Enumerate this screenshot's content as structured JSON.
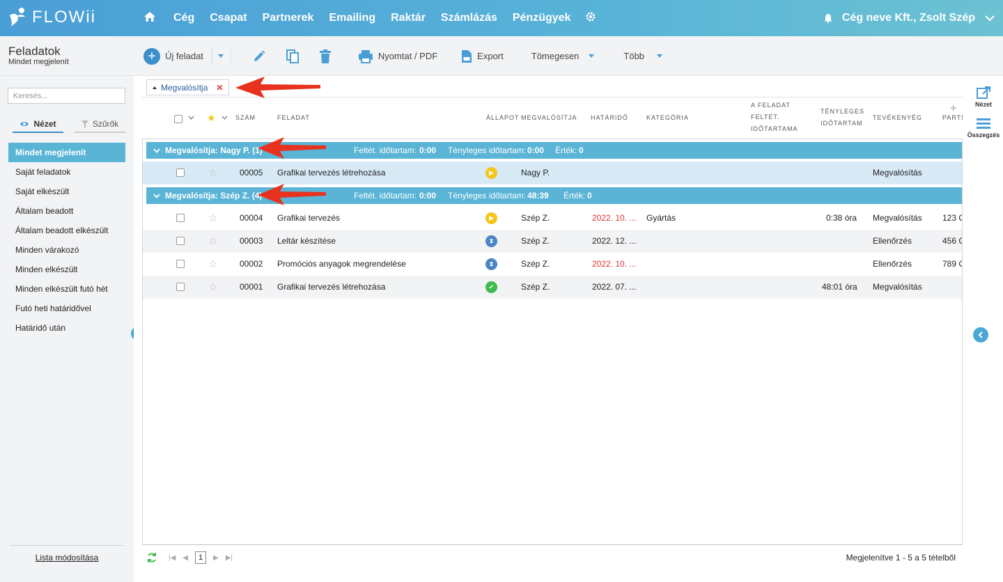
{
  "app": {
    "logo_text": "FLOWii"
  },
  "nav": {
    "items": [
      "Cég",
      "Csapat",
      "Partnerek",
      "Emailing",
      "Raktár",
      "Számlázás",
      "Pénzügyek"
    ]
  },
  "user": {
    "label": "Cég neve Kft., Zsolt Szép"
  },
  "page": {
    "title": "Feladatok",
    "subtitle": "Mindet megjelenít"
  },
  "toolbar": {
    "new_task": "Új feladat",
    "print": "Nyomtat / PDF",
    "export": "Export",
    "bulk": "Tömegesen",
    "more": "Több"
  },
  "sidebar": {
    "search_placeholder": "Keresés...",
    "tabs": {
      "view": "Nézet",
      "filters": "Szűrők"
    },
    "items": [
      "Mindet megjelenít",
      "Saját feladatok",
      "Saját elkészült",
      "Általam beadott",
      "Általam beadott elkészült",
      "Minden várakozó",
      "Minden elkészült",
      "Minden elkészült futó hét",
      "Futó heti határidővel",
      "Határidő után"
    ],
    "edit_list": "Lista módosítása"
  },
  "group_chip": {
    "label": "Megvalósítja"
  },
  "columns": {
    "num": "SZÁM",
    "task": "FELADAT",
    "status": "ÁLLAPOT",
    "assignee": "MEGVALÓSÍTJA",
    "deadline": "HATÁRIDŐ",
    "category": "KATEGÓRIA",
    "planned_1": "A FELADAT",
    "planned_2": "FELTÉT.",
    "planned_3": "IDŐTARTAMA",
    "actual_1": "TÉNYLEGES",
    "actual_2": "IDŐTARTAM",
    "activity": "TEVÉKENYÉG",
    "partner": "PARTNER"
  },
  "groups": [
    {
      "title": "Megvalósítja: Nagy P. (1)",
      "planned_label": "Feltét. időtartam:",
      "planned_value": "0:00",
      "actual_label": "Tényleges időtartam:",
      "actual_value": "0:00",
      "value_label": "Érték:",
      "value_value": "0"
    },
    {
      "title": "Megvalósítja: Szép Z. (4)",
      "planned_label": "Feltét. időtartam:",
      "planned_value": "0:00",
      "actual_label": "Tényleges időtartam:",
      "actual_value": "48:39",
      "value_label": "Érték:",
      "value_value": "0"
    }
  ],
  "rows": [
    {
      "num": "00005",
      "task": "Grafikai tervezés létrehozása",
      "status": "in-progress",
      "assignee": "Nagy P.",
      "deadline": "",
      "category": "",
      "actual": "",
      "activity": "Megvalósítás",
      "partner": ""
    },
    {
      "num": "00004",
      "task": "Grafikai tervezés",
      "status": "in-progress",
      "assignee": "Szép Z.",
      "deadline": "2022. 10. ...",
      "category": "Gyártás",
      "actual": "0:38 óra",
      "activity": "Megvalósítás",
      "partner": "123 C"
    },
    {
      "num": "00003",
      "task": "Leltár készítése",
      "status": "waiting",
      "assignee": "Szép Z.",
      "deadline": "2022. 12. ...",
      "category": "",
      "actual": "",
      "activity": "Ellenőrzés",
      "partner": "456 C"
    },
    {
      "num": "00002",
      "task": "Promóciós anyagok megrendelése",
      "status": "waiting",
      "assignee": "Szép Z.",
      "deadline": "2022. 10. ...",
      "category": "",
      "actual": "",
      "activity": "Ellenőrzés",
      "partner": "789 C"
    },
    {
      "num": "00001",
      "task": "Grafikai tervezés létrehozása",
      "status": "done",
      "assignee": "Szép Z.",
      "deadline": "2022. 07. ...",
      "category": "",
      "actual": "48:01 óra",
      "activity": "Megvalósítás",
      "partner": ""
    }
  ],
  "pager": {
    "page": "1",
    "summary": "Megjelenítve 1 - 5 a 5 tételből"
  },
  "right_panel": {
    "view": "Nézet",
    "summary": "Összegzés"
  },
  "colors": {
    "accent": "#5ab4d5",
    "header_start": "#4a9ed6",
    "overdue": "#dd3333",
    "in_progress": "#f5c518",
    "waiting": "#4a86c5",
    "done": "#3dbb4f",
    "annotation_arrow": "#e8321e"
  }
}
